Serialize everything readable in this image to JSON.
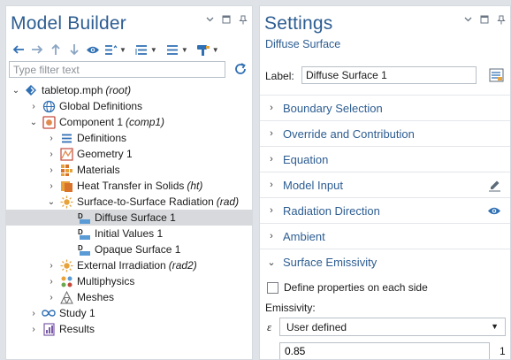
{
  "model_builder": {
    "title": "Model Builder",
    "filter_placeholder": "Type filter text",
    "tree": [
      {
        "label": "tabletop.mph",
        "sub": "(root)",
        "icon": "model-file-icon"
      },
      {
        "label": "Global Definitions",
        "sub": "",
        "icon": "globe-icon"
      },
      {
        "label": "Component 1",
        "sub": "(comp1)",
        "icon": "component-icon"
      },
      {
        "label": "Definitions",
        "sub": "",
        "icon": "definitions-icon"
      },
      {
        "label": "Geometry 1",
        "sub": "",
        "icon": "geometry-icon"
      },
      {
        "label": "Materials",
        "sub": "",
        "icon": "materials-icon"
      },
      {
        "label": "Heat Transfer in Solids",
        "sub": "(ht)",
        "icon": "heat-transfer-icon"
      },
      {
        "label": "Surface-to-Surface Radiation",
        "sub": "(rad)",
        "icon": "radiation-sun-icon"
      },
      {
        "label": "Diffuse Surface 1",
        "sub": "",
        "icon": "boundary-node-icon"
      },
      {
        "label": "Initial Values 1",
        "sub": "",
        "icon": "boundary-node-icon"
      },
      {
        "label": "Opaque Surface 1",
        "sub": "",
        "icon": "boundary-node-icon"
      },
      {
        "label": "External Irradiation",
        "sub": "(rad2)",
        "icon": "radiation-sun-icon"
      },
      {
        "label": "Multiphysics",
        "sub": "",
        "icon": "multiphysics-icon"
      },
      {
        "label": "Meshes",
        "sub": "",
        "icon": "mesh-icon"
      },
      {
        "label": "Study 1",
        "sub": "",
        "icon": "study-icon"
      },
      {
        "label": "Results",
        "sub": "",
        "icon": "results-icon"
      }
    ]
  },
  "settings": {
    "title": "Settings",
    "subtitle": "Diffuse Surface",
    "label_caption": "Label:",
    "label_value": "Diffuse Surface 1",
    "sections": [
      {
        "title": "Boundary Selection",
        "expanded": false,
        "right_icon": ""
      },
      {
        "title": "Override and Contribution",
        "expanded": false,
        "right_icon": ""
      },
      {
        "title": "Equation",
        "expanded": false,
        "right_icon": ""
      },
      {
        "title": "Model Input",
        "expanded": false,
        "right_icon": "edit-icon"
      },
      {
        "title": "Radiation Direction",
        "expanded": false,
        "right_icon": "eye-icon"
      },
      {
        "title": "Ambient",
        "expanded": false,
        "right_icon": ""
      },
      {
        "title": "Surface Emissivity",
        "expanded": true,
        "right_icon": ""
      }
    ],
    "define_each_side": "Define properties on each side",
    "emissivity_label": "Emissivity:",
    "epsilon_symbol": "ε",
    "emissivity_option": "User defined",
    "emissivity_value": "0.85",
    "emissivity_unit": "1"
  },
  "colors": {
    "accent": "#2d5d92",
    "selected_row": "#d7d9dc",
    "background": "#dfe3e8"
  }
}
